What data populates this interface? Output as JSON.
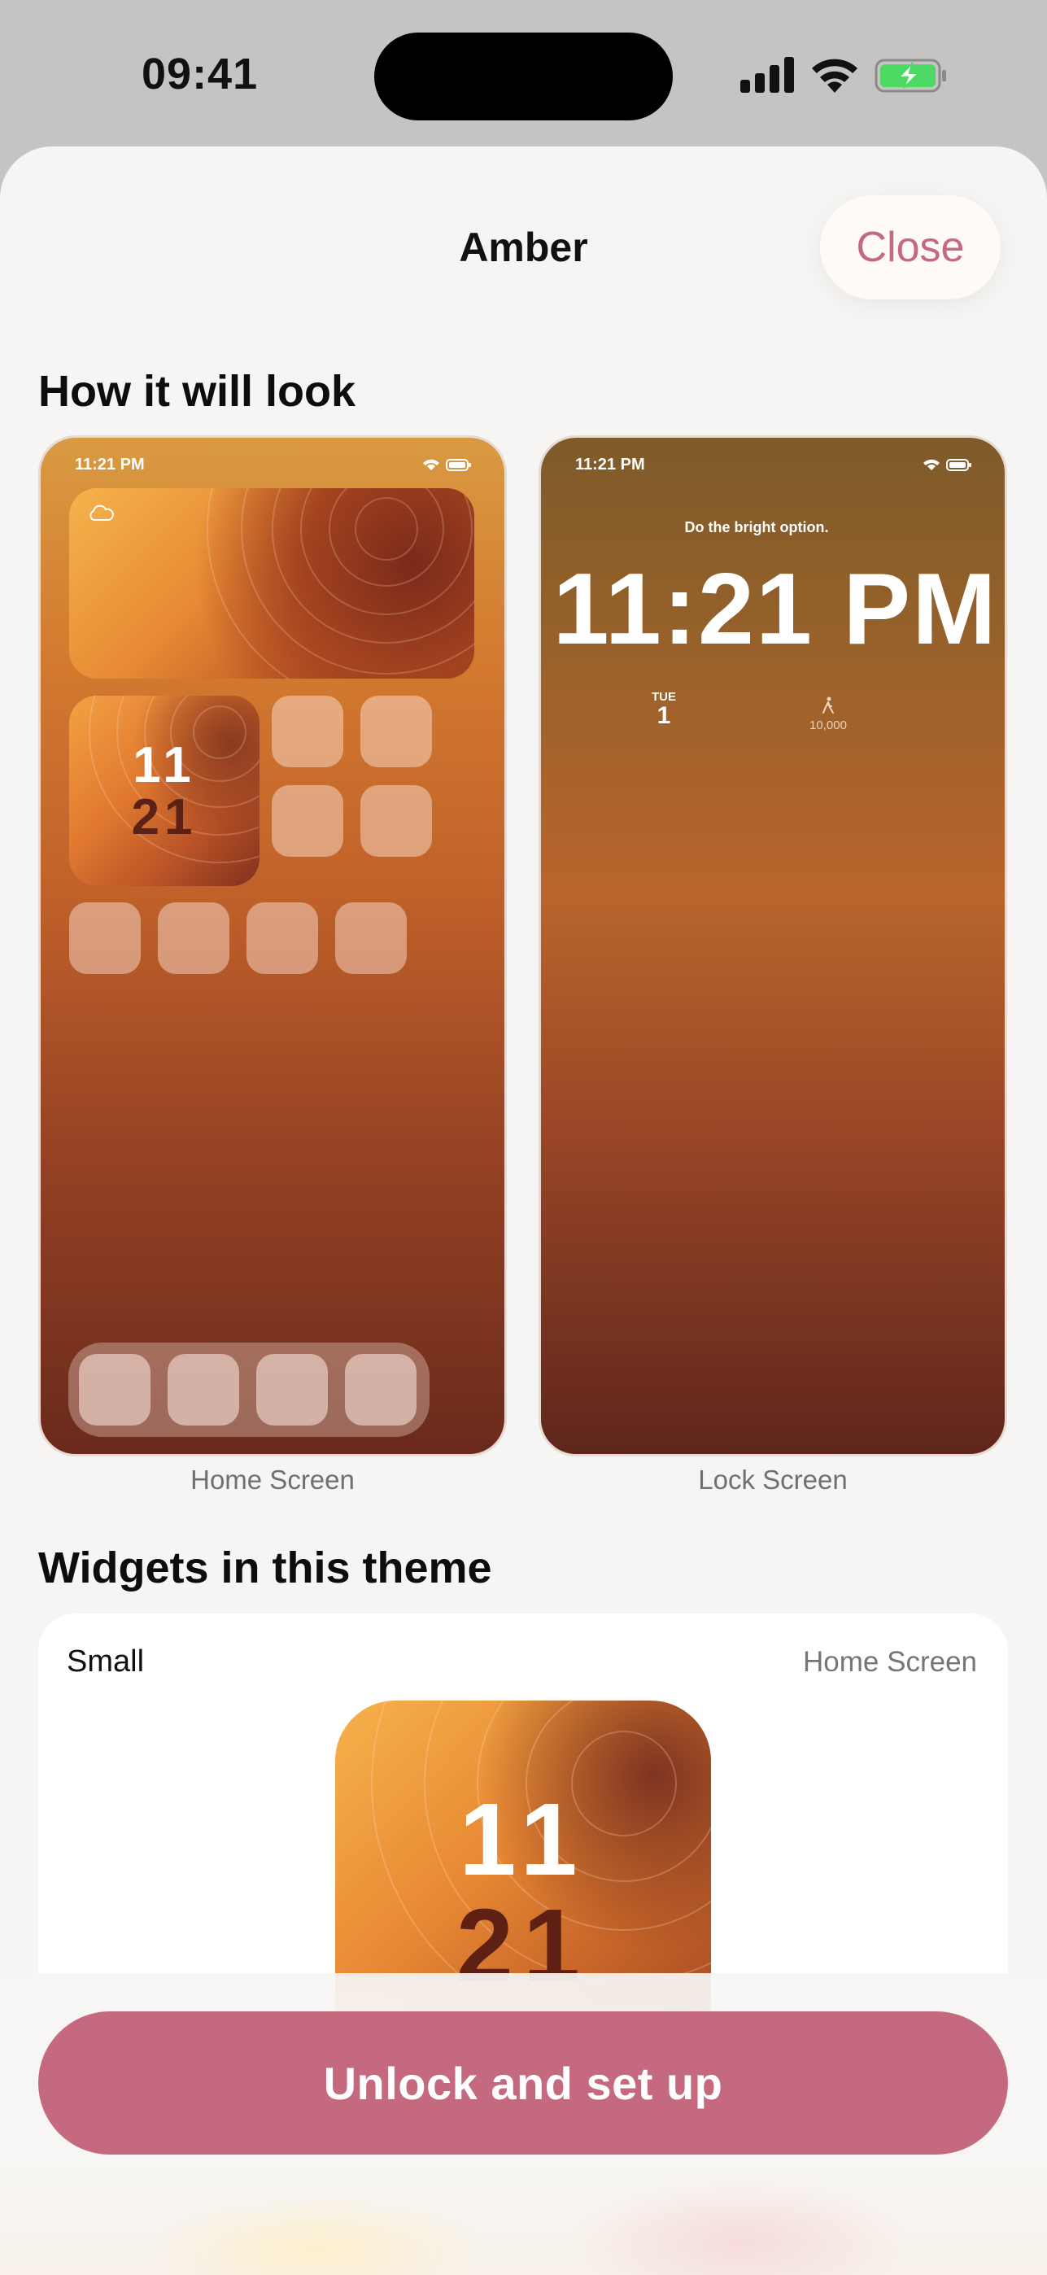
{
  "status_bar": {
    "time": "09:41",
    "icons": [
      "cellular-signal-icon",
      "wifi-icon",
      "battery-charging-icon"
    ],
    "battery_color": "#4cd964"
  },
  "sheet": {
    "title": "Amber",
    "close_label": "Close",
    "accent_color": "#c4697e"
  },
  "preview_section": {
    "title": "How it will look",
    "home": {
      "caption": "Home Screen",
      "status_time": "11:21 PM",
      "widget_icon": "cloud-icon",
      "clock_hour": "11",
      "clock_minute": "21"
    },
    "lock": {
      "caption": "Lock Screen",
      "status_time": "11:21 PM",
      "message": "Do the bright option.",
      "clock": "11:21 PM",
      "day_label": "TUE",
      "day_number": "1",
      "steps_icon": "walking-icon",
      "steps_value": "10,000"
    }
  },
  "widgets_section": {
    "title": "Widgets in this theme",
    "card": {
      "size_label": "Small",
      "location_label": "Home Screen",
      "clock_hour": "11",
      "clock_minute": "21"
    }
  },
  "cta": {
    "label": "Unlock and set up"
  }
}
